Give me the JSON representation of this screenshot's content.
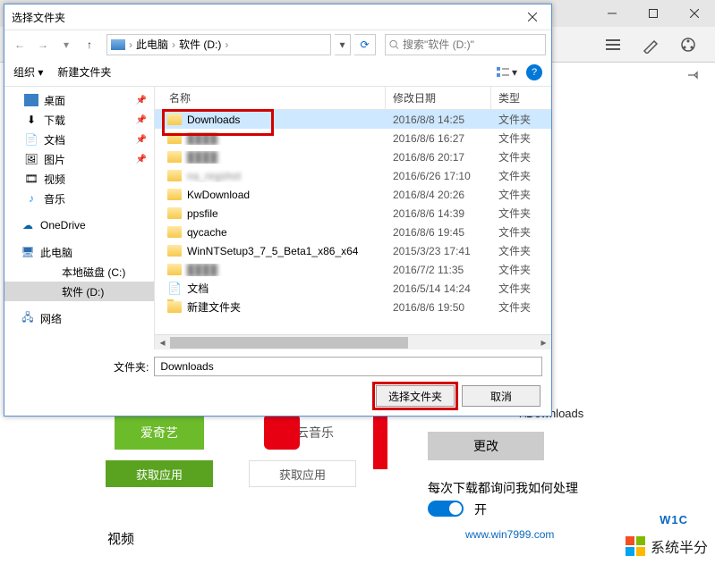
{
  "dialog": {
    "title": "选择文件夹",
    "nav": {
      "path1": "此电脑",
      "path2": "软件 (D:)",
      "search_placeholder": "搜索\"软件 (D:)\""
    },
    "toolbar": {
      "organize": "组织",
      "new_folder": "新建文件夹"
    },
    "tree": {
      "desktop": "桌面",
      "downloads": "下载",
      "documents": "文档",
      "pictures": "图片",
      "videos": "视频",
      "music": "音乐",
      "onedrive": "OneDrive",
      "this_pc": "此电脑",
      "local_c": "本地磁盘 (C:)",
      "soft_d": "软件 (D:)",
      "network": "网络"
    },
    "columns": {
      "name": "名称",
      "date": "修改日期",
      "type": "类型"
    },
    "rows": [
      {
        "name": "Downloads",
        "date": "2016/8/8 14:25",
        "type": "文件夹",
        "selected": true
      },
      {
        "name": "████",
        "date": "2016/8/6 16:27",
        "type": "文件夹",
        "blur": true
      },
      {
        "name": "████",
        "date": "2016/8/6 20:17",
        "type": "文件夹",
        "blur": true
      },
      {
        "name": "na_regshot",
        "date": "2016/6/26 17:10",
        "type": "文件夹",
        "blur": true
      },
      {
        "name": "KwDownload",
        "date": "2016/8/4 20:26",
        "type": "文件夹"
      },
      {
        "name": "ppsfile",
        "date": "2016/8/6 14:39",
        "type": "文件夹"
      },
      {
        "name": "qycache",
        "date": "2016/8/6 19:45",
        "type": "文件夹"
      },
      {
        "name": "WinNTSetup3_7_5_Beta1_x86_x64",
        "date": "2015/3/23 17:41",
        "type": "文件夹"
      },
      {
        "name": "████",
        "date": "2016/7/2 11:35",
        "type": "文件夹",
        "blur": true
      },
      {
        "name": "文档",
        "date": "2016/5/14 14:24",
        "type": "文件夹",
        "docico": true
      },
      {
        "name": "新建文件夹",
        "date": "2016/8/6 19:50",
        "type": "文件夹"
      }
    ],
    "folder_label": "文件夹:",
    "folder_value": "Downloads",
    "select_btn": "选择文件夹",
    "cancel_btn": "取消"
  },
  "bg": {
    "path_tail": "r\\Downloads",
    "change": "更改",
    "ask": "每次下载都询问我如何处理",
    "on": "开",
    "tile1": "爱奇艺",
    "tile1_link": "获取应用",
    "tile2": "网易云音乐",
    "tile2_link": "获取应用",
    "video": "视频"
  },
  "wm": {
    "brand": "系统半分",
    "url": "www.win7999.com",
    "w1c": "W1C"
  }
}
